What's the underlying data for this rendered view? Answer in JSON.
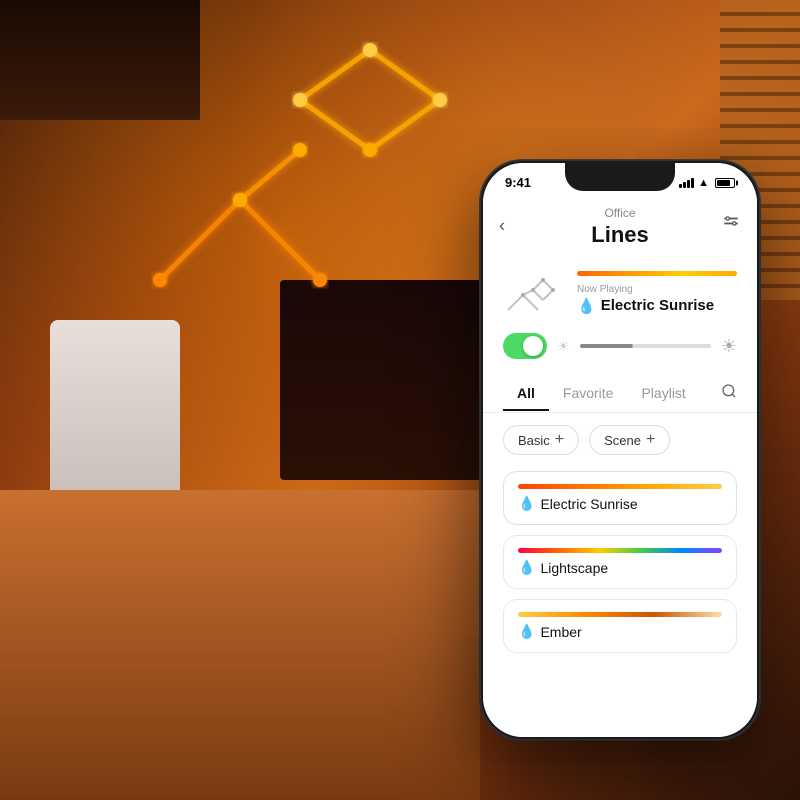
{
  "background": {
    "description": "Office room with warm orange lighting"
  },
  "phone": {
    "status_bar": {
      "time": "9:41",
      "signal": true,
      "wifi": true,
      "battery_percent": 70
    },
    "header": {
      "location": "Office",
      "title": "Lines",
      "back_label": "‹",
      "settings_label": "⊕"
    },
    "scene_preview": {
      "now_playing_label": "Now Playing",
      "scene_name": "Electric Sunrise",
      "drop_icon": "💧"
    },
    "controls": {
      "toggle_on": true,
      "brightness_percent": 40
    },
    "tabs": [
      {
        "label": "All",
        "active": true
      },
      {
        "label": "Favorite",
        "active": false
      },
      {
        "label": "Playlist",
        "active": false
      }
    ],
    "filters": [
      {
        "label": "Basic"
      },
      {
        "label": "Scene"
      }
    ],
    "scenes": [
      {
        "name": "Electric Sunrise",
        "color_type": "electric-sunrise",
        "active": true
      },
      {
        "name": "Lightscape",
        "color_type": "lightscape",
        "active": false
      },
      {
        "name": "Ember",
        "color_type": "ember",
        "active": false
      }
    ]
  }
}
